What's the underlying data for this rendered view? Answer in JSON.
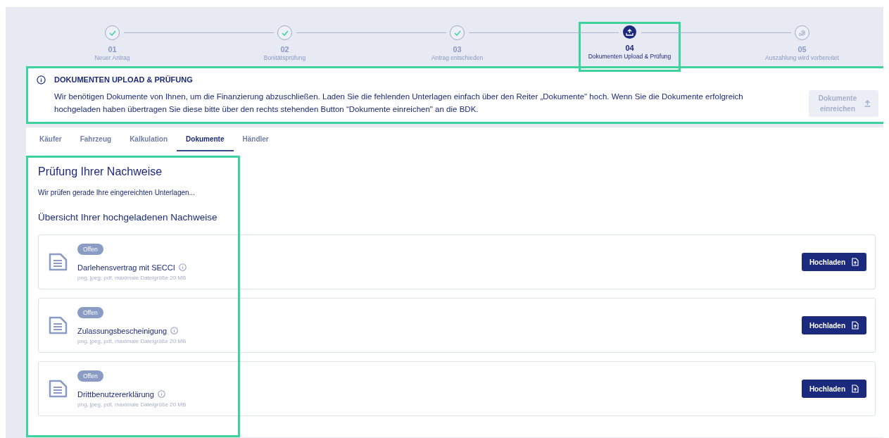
{
  "steps": [
    {
      "number": "01",
      "label": "Neuer Antrag",
      "kind": "done",
      "highlighted": false
    },
    {
      "number": "02",
      "label": "Bonitätsprüfung",
      "kind": "done",
      "highlighted": false
    },
    {
      "number": "03",
      "label": "Antrag entschieden",
      "kind": "done",
      "highlighted": false
    },
    {
      "number": "04",
      "label": "Dokumenten Upload & Prüfung",
      "kind": "active",
      "highlighted": true
    },
    {
      "number": "05",
      "label": "Auszahlung wird vorbereitet",
      "kind": "upcoming",
      "highlighted": false
    }
  ],
  "banner": {
    "title": "DOKUMENTEN UPLOAD & PRÜFUNG",
    "text": "Wir benötigen Dokumente von Ihnen, um die Finanzierung abzuschließen. Laden Sie die fehlenden Unterlagen einfach über den Reiter „Dokumente\" hoch. Wenn Sie die Dokumente erfolgreich hochgeladen haben übertragen Sie diese bitte über den rechts stehenden Button “Dokumente einreichen\" an die BDK.",
    "button": "Dokumente einreichen",
    "button_disabled": true,
    "highlighted": true
  },
  "tabs": [
    {
      "label": "Käufer",
      "selected": false
    },
    {
      "label": "Fahrzeug",
      "selected": false
    },
    {
      "label": "Kalkulation",
      "selected": false
    },
    {
      "label": "Dokumente",
      "selected": true
    },
    {
      "label": "Händler",
      "selected": false
    }
  ],
  "section": {
    "title": "Prüfung Ihrer Nachweise",
    "status": "Wir prüfen gerade Ihre eingereichten Unterlagen...",
    "subtitle": "Übersicht Ihrer hochgeladenen Nachweise",
    "highlighted": true
  },
  "documents": [
    {
      "status": "Offen",
      "name": "Darlehensvertrag mit SECCI",
      "hint": "png, jpeg, pdf, maximale Dateigröße 20 MB",
      "button": "Hochladen"
    },
    {
      "status": "Offen",
      "name": "Zulassungsbescheinigung",
      "hint": "png, jpeg, pdf, maximale Dateigröße 20 MB",
      "button": "Hochladen"
    },
    {
      "status": "Offen",
      "name": "Drittbenutzererklärung",
      "hint": "png, jpeg, pdf, maximale Dateigröße 20 MB",
      "button": "Hochladen"
    }
  ]
}
